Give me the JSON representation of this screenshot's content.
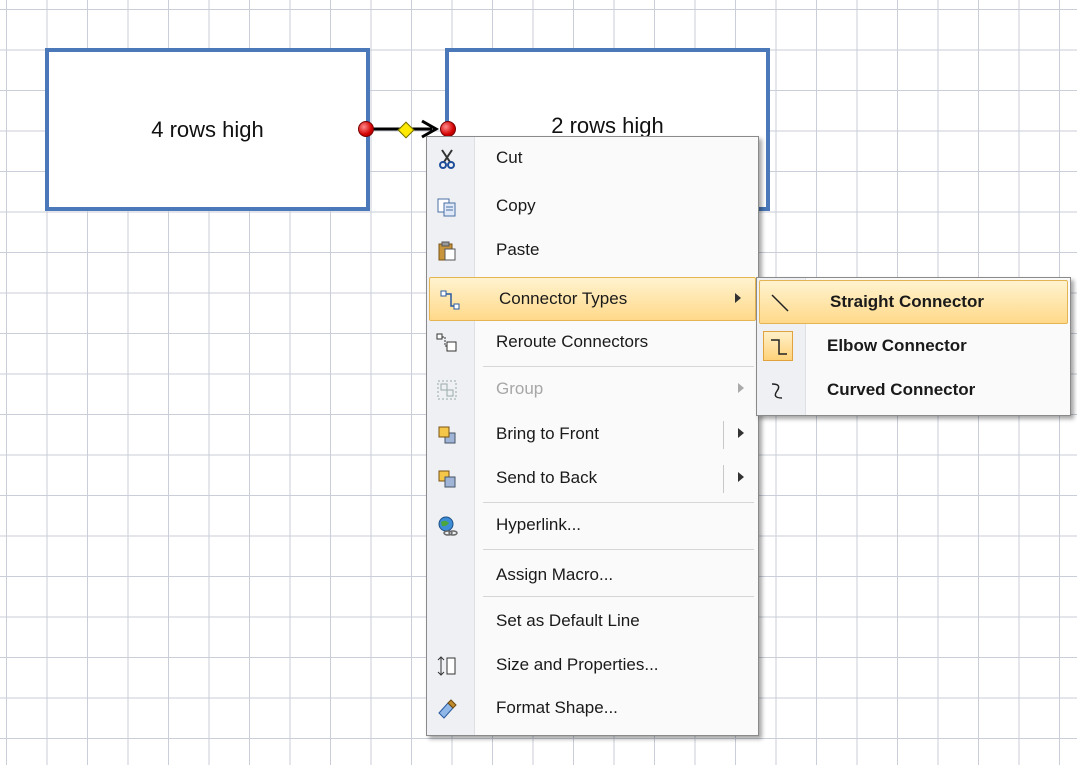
{
  "canvas": {
    "shape_left_label": "4 rows high",
    "shape_right_label": "2 rows high"
  },
  "context_menu": {
    "items": [
      {
        "label": "Cut",
        "icon": "scissors-icon"
      },
      {
        "label": "Copy",
        "icon": "copy-icon"
      },
      {
        "label": "Paste",
        "icon": "paste-icon"
      },
      {
        "label": "Connector Types",
        "icon": "connector-types-icon",
        "submenu": true,
        "highlighted": true
      },
      {
        "label": "Reroute Connectors",
        "icon": "reroute-connectors-icon"
      },
      {
        "label": "Group",
        "icon": "group-icon",
        "submenu": true,
        "disabled": true
      },
      {
        "label": "Bring to Front",
        "icon": "bring-to-front-icon",
        "submenu": true
      },
      {
        "label": "Send to Back",
        "icon": "send-to-back-icon",
        "submenu": true
      },
      {
        "label": "Hyperlink...",
        "icon": "hyperlink-icon"
      },
      {
        "label": "Assign Macro..."
      },
      {
        "label": "Set as Default Line"
      },
      {
        "label": "Size and Properties...",
        "icon": "size-properties-icon"
      },
      {
        "label": "Format Shape...",
        "icon": "format-shape-icon"
      }
    ]
  },
  "submenu": {
    "items": [
      {
        "label": "Straight Connector",
        "icon": "straight-connector-icon",
        "highlighted": true
      },
      {
        "label": "Elbow Connector",
        "icon": "elbow-connector-icon",
        "selected": true
      },
      {
        "label": "Curved Connector",
        "icon": "curved-connector-icon"
      }
    ]
  },
  "colors": {
    "shape_border": "#4a78b8",
    "highlight": "#ffd98a",
    "grid": "#c9ced8"
  }
}
